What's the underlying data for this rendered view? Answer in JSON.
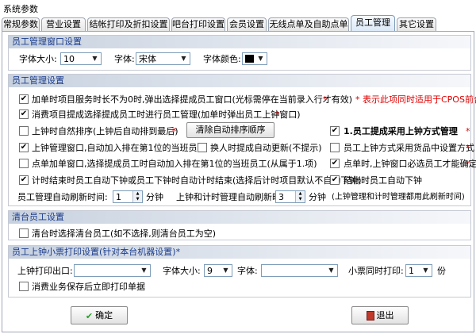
{
  "window": {
    "title": "系统参数"
  },
  "tabs": [
    {
      "label": "常规参数"
    },
    {
      "label": "营业设置"
    },
    {
      "label": "结帐打印及折扣设置"
    },
    {
      "label": "吧台打印设置"
    },
    {
      "label": "会员设置"
    },
    {
      "label": "无线点单及自助点单"
    },
    {
      "label": "员工管理"
    },
    {
      "label": "其它设置"
    }
  ],
  "window_section": {
    "title": "员工管理窗口设置",
    "font_size_label": "字体大小:",
    "font_size_value": "10",
    "font_label": "字体:",
    "font_value": "宋体",
    "font_color_label": "字体颜色:"
  },
  "staff_mgmt": {
    "title": "员工管理设置",
    "opt_service_time": "加单时项目服务时长不为0时,弹出选择提成员工窗口(光标需停在当前录入行才有效)",
    "note_cpos": "* 表示此项同时适用于CPOS前台",
    "opt_consume_select": "消费项目提成选择提成员工时进行员工管理(加单时弹出员工上钟窗口)",
    "opt_natural_sort": "上钟时自然排序(上钟后自动排到最后)",
    "clear_sort_button": "清除自动排序顺序",
    "opt_shift_mode": "1.员工提成采用上钟方式管理",
    "opt_first_on_duty": "上钟管理窗口,自动加入排在第1位的当班员工",
    "opt_auto_refresh": "换人时提成自动更新(不提示)",
    "opt_goods_setting": "员工上钟方式采用货品中设置方式",
    "opt_order_auto_first": "点单加单窗口,选择提成员工时自动加入排在第1位的当班员工(从属于1.项)",
    "opt_must_confirm": "点单时,上钟窗口必选员工才能确定",
    "opt_timer_end": "计时结束时员工自动下钟或员工下钟时自动计时结束(选择后计时项目默认不自动下钟)",
    "opt_checkout_off": "结帐时员工自动下钟",
    "auto_refresh_label": "员工管理自动刷新时间:",
    "auto_refresh_value": "1",
    "unit_minute": "分钟",
    "shift_refresh_label": "上钟和计时管理自动刷新时间:",
    "shift_refresh_value": "3",
    "shift_refresh_note": "(上钟管理和计时管理都用此刷新时间)"
  },
  "clear_staff": {
    "title": "清台员工设置",
    "opt_select_on_clear": "清台时选择清台员工(如不选择,则清台员工为空)"
  },
  "ticket_print": {
    "title": "员工上钟小票打印设置(针对本台机器设置)*",
    "port_label": "上钟打印出口:",
    "port_value": "",
    "font_size_label": "字体大小:",
    "font_size_value": "9",
    "font_label": "字体:",
    "font_value": "",
    "copies_label": "小票同时打印:",
    "copies_value": "1",
    "copies_unit": "份",
    "opt_print_after_save": "消费业务保存后立即打印单据"
  },
  "buttons": {
    "ok": "确定",
    "exit": "退出"
  },
  "colors": {
    "accent_red": "#e00000",
    "section_title": "#1b3c8c",
    "font_color_value": "#000000"
  }
}
